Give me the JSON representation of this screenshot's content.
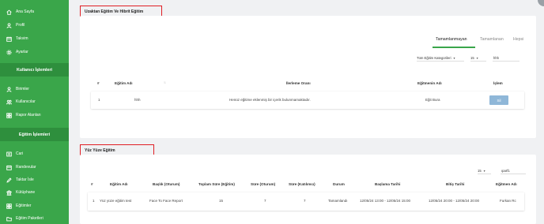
{
  "sidebar": {
    "top_items": [
      {
        "label": "Ana Sayfa",
        "icon": "home-icon"
      },
      {
        "label": "Profil",
        "icon": "user-icon"
      },
      {
        "label": "Takvim",
        "icon": "calendar-icon"
      },
      {
        "label": "Ayarlar",
        "icon": "gear-icon"
      }
    ],
    "section1_title": "Kullanıcı İşlemleri",
    "section1_items": [
      {
        "label": "Birimler",
        "icon": "user-icon"
      },
      {
        "label": "Kullanıcılar",
        "icon": "users-icon"
      },
      {
        "label": "Rapor Alanları",
        "icon": "grid-icon"
      }
    ],
    "section2_title": "Eğitim İşlemleri",
    "section2_items": [
      {
        "label": "Cari",
        "icon": "list-icon"
      },
      {
        "label": "Randevular",
        "icon": "calendar-icon"
      },
      {
        "label": "Taktar İsle",
        "icon": "edit-icon"
      },
      {
        "label": "Kütüphane",
        "icon": "library-icon"
      },
      {
        "label": "Eğitimler",
        "icon": "grid-icon"
      },
      {
        "label": "Eğitim Paketleri",
        "icon": "folder-icon"
      }
    ]
  },
  "card1": {
    "title": "Uzaktan Eğitim Ve Hibrit Eğitim",
    "tabs": [
      "Tamamlanmayan",
      "Tamamlanan",
      "Hepsi"
    ],
    "filter_label": "Tüm Eğitim Kategorileri",
    "page_size": "15",
    "search_value": "hhh",
    "columns": [
      "#",
      "Eğitim Adı",
      "İlerleme Oranı",
      "Eğitmenin Adı",
      "İşlem"
    ],
    "rows": [
      {
        "no": "1",
        "name": "hhh",
        "progress": "Henüz eğitime eklenmiş bir içerik bulunmamaktadır.",
        "trainer": "Eğit Bura",
        "action": "Sil"
      }
    ]
  },
  "card2": {
    "title": "Yüz Yüze Eğitim",
    "page_size": "15",
    "search_value": "ıparf1",
    "columns": [
      "#",
      "Eğitim Adı",
      "Başlık (Oturum)",
      "Toplam Süre (Eğitim)",
      "Süre (Oturum)",
      "Süre (Katılımcı)",
      "Durum",
      "Başlama Tarihi",
      "Bitiş Tarihi",
      "Eğitmen Adı"
    ],
    "rows": [
      {
        "no": "1",
        "name": "Yüz yüze eğitim test",
        "session": "Face To Face Report",
        "total": "15",
        "session_dur": "7",
        "participant_dur": "7",
        "status": "Tamamlandı",
        "start": "12/05/24 13:00 - 12/05/24 15:00",
        "end": "12/05/24 20:00 - 12/05/24 20:00",
        "trainer": "Furkan Rc"
      }
    ]
  },
  "colors": {
    "accent": "#3aa64a",
    "sidebar_section": "#2e8f3d",
    "highlight_border": "#e01e24",
    "delete_button": "#8fb7d8"
  }
}
